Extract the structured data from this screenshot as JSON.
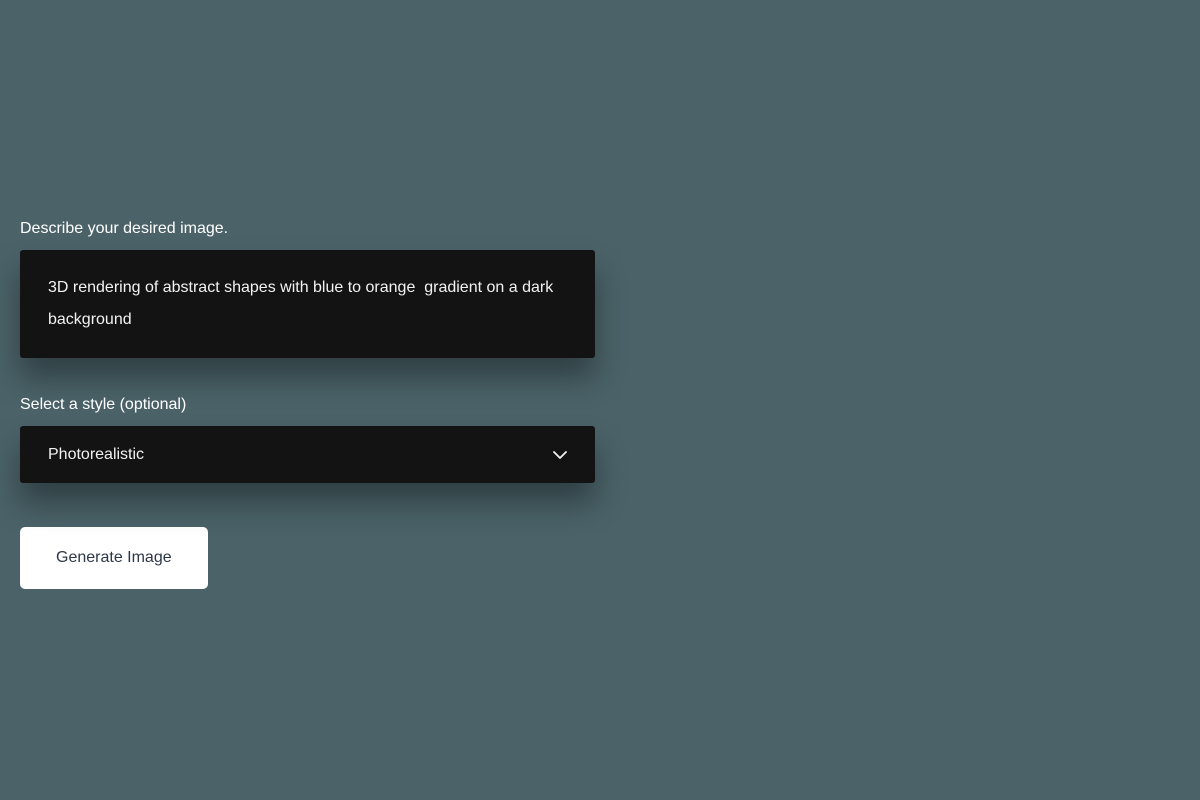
{
  "form": {
    "prompt": {
      "label": "Describe your desired image.",
      "value": "3D rendering of abstract shapes with blue to orange  gradient on a dark background"
    },
    "style": {
      "label": "Select a style (optional)",
      "selected": "Photorealistic"
    },
    "generate_button_label": "Generate Image"
  }
}
